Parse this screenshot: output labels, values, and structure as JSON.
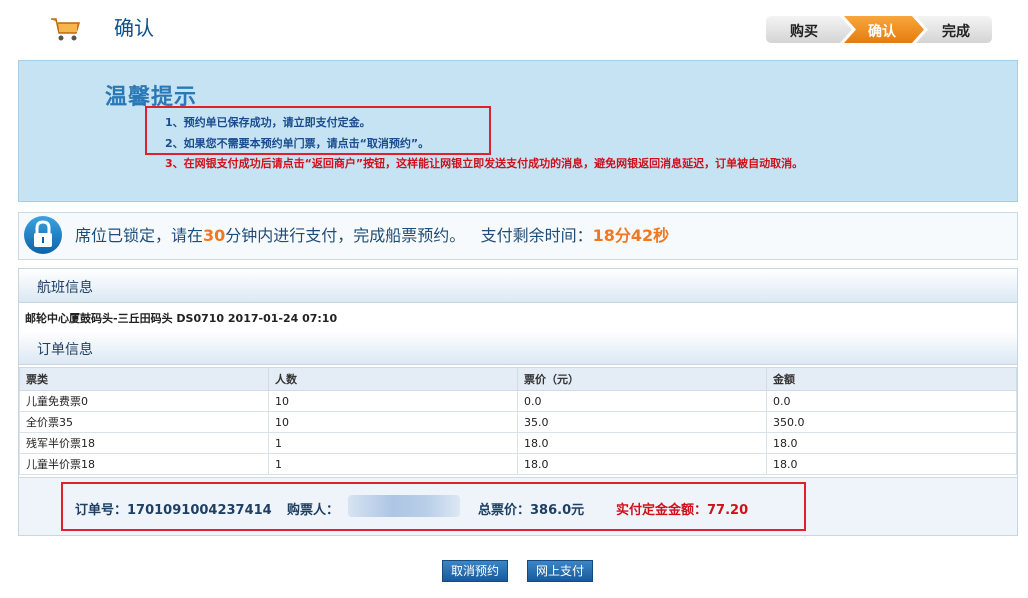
{
  "header": {
    "title": "确认",
    "steps": [
      {
        "label": "购买",
        "active": false
      },
      {
        "label": "确认",
        "active": true
      },
      {
        "label": "完成",
        "active": false
      }
    ]
  },
  "tips": {
    "title": "温馨提示",
    "items": [
      "1、预约单已保存成功，请立即支付定金。",
      "2、如果您不需要本预约单门票，请点击“取消预约”。",
      "3、在网银支付成功后请点击“返回商户”按钮，这样能让网银立即发送支付成功的消息，避免网银返回消息延迟，订单被自动取消。"
    ]
  },
  "lock": {
    "text_pre": "席位已锁定，请在",
    "minutes": "30",
    "text_post": "分钟内进行支付，完成船票预约。",
    "remain_label": "支付剩余时间：",
    "remain_time": "18分42秒"
  },
  "flight": {
    "title": "航班信息",
    "route": "邮轮中心厦鼓码头-三丘田码头 DS0710 2017-01-24 07:10"
  },
  "order": {
    "title": "订单信息",
    "columns": [
      "票类",
      "人数",
      "票价（元）",
      "金额"
    ],
    "rows": [
      [
        "儿童免费票0",
        "10",
        "0.0",
        "0.0"
      ],
      [
        "全价票35",
        "10",
        "35.0",
        "350.0"
      ],
      [
        "残军半价票18",
        "1",
        "18.0",
        "18.0"
      ],
      [
        "儿童半价票18",
        "1",
        "18.0",
        "18.0"
      ]
    ],
    "summary": {
      "order_no": "订单号：1701091004237414",
      "buyer": "购票人：",
      "total": "总票价：386.0元",
      "deposit": "实付定金金额：77.20"
    }
  },
  "actions": {
    "cancel": "取消预约",
    "pay": "网上支付"
  },
  "colors": {
    "accent": "#f07820",
    "brand": "#1a5a9a",
    "alert": "#d0101a"
  }
}
